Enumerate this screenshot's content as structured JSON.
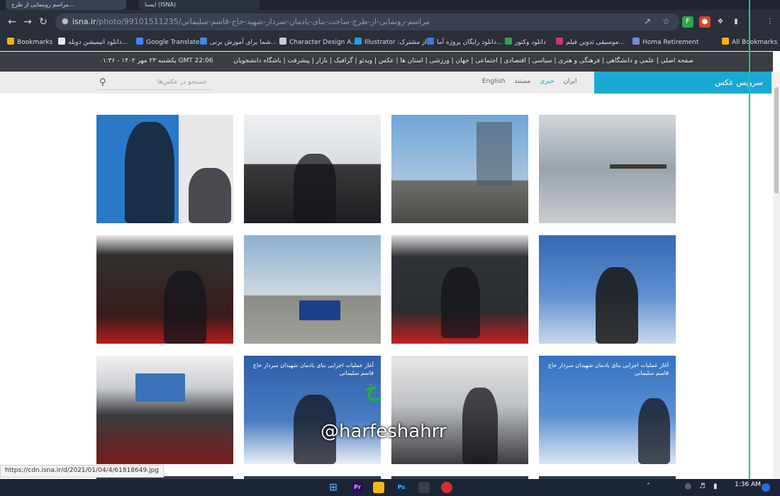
{
  "browser": {
    "tabs": [
      {
        "label": "مراسم روبنمایی از طرح..."
      },
      {
        "label": "ایسنا (ISNA)"
      }
    ],
    "url_domain": "isna.ir",
    "url_path": "/photo/99101511235/مراسم-رونمایی-از-طرح-ساخت-بنای-یادمان-سردار-شهید-حاج-قاسم-سلیمانی",
    "status_url": "https://cdn.isna.ir/d/2021/01/04/4/61818649.jpg"
  },
  "bookmarks": [
    {
      "label": "Bookmarks",
      "color": "#f5b400"
    },
    {
      "label": "دانلود انیمیشن دوبله...",
      "color": "#e8e8e8"
    },
    {
      "label": "Google Translate",
      "color": "#4285f4"
    },
    {
      "label": "شما برای آموزش برنی...",
      "color": "#3d8bd9"
    },
    {
      "label": "Character Design A...",
      "color": "#cccccc"
    },
    {
      "label": "Illustrator :از مشترک",
      "color": "#2c9be0"
    },
    {
      "label": "دانلود رایگان پروژه آما...",
      "color": "#3a7bd5"
    },
    {
      "label": "دانلود وکتور",
      "color": "#2aa84a"
    },
    {
      "label": "موسیقی تدوین فیلم...",
      "color": "#c73a6e"
    },
    {
      "label": "Homa Retirement",
      "color": "#7a8bd9"
    },
    {
      "label": "All Bookmarks",
      "color": "#f5b400"
    }
  ],
  "site": {
    "date": "یکشنبه ۲۳ مهر ۱۴۰۲ - ۰۱:۳۶  GMT 22:06",
    "nav": "صفحه اصلی | علمی و دانشگاهی | فرهنگی و هنری | سیاسی | اقتصادی | اجتماعی | جهان | ورزشی | استان ها | عکس | ویدئو | گرافیک | بازار | پیشرفت | باشگاه دانشجویان",
    "search_placeholder": "جستجو در عکس‌ها",
    "langs": [
      "English",
      "ایران",
      "خبری",
      "مستند"
    ],
    "photo_service": "سرویس عکس"
  },
  "gallery": [
    {
      "caption": ""
    },
    {
      "caption": ""
    },
    {
      "caption": ""
    },
    {
      "caption": ""
    },
    {
      "caption": ""
    },
    {
      "caption": ""
    },
    {
      "caption": ""
    },
    {
      "caption": ""
    },
    {
      "caption": ""
    },
    {
      "caption": "آغاز عملیات اجرایی بنای یادمان شهیدان سردار حاج قاسم سلیمانی"
    },
    {
      "caption": ""
    },
    {
      "caption": "آغاز عملیات اجرایی بنای یادمان شهیدان سردار حاج قاسم سلیمانی"
    }
  ],
  "watermark": "@harfeshahrr",
  "taskbar": {
    "time": "1:36 AM",
    "apps": [
      "Pr",
      "Ps"
    ]
  },
  "colors": {
    "accent": "#19a9d3",
    "header_dark": "#3a3d42"
  }
}
